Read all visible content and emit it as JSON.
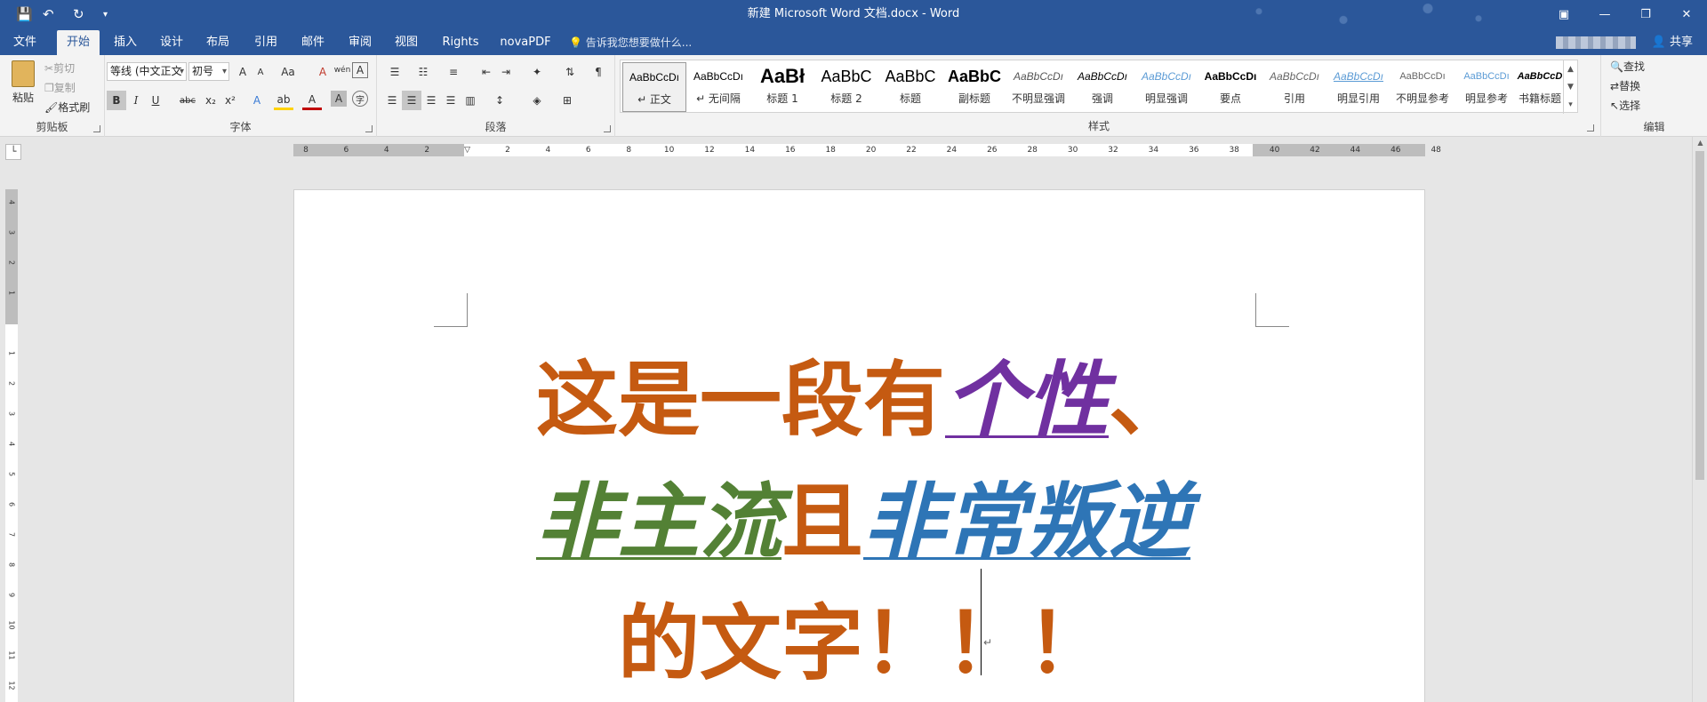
{
  "window": {
    "title": "新建 Microsoft Word 文档.docx - Word",
    "minimize_icon": "—",
    "restore_icon": "❐",
    "close_icon": "✕",
    "ribbon_display_icon": "▣"
  },
  "quick_access": {
    "save_icon": "💾",
    "undo_icon": "↶",
    "redo_icon": "↻",
    "customize_icon": "▾"
  },
  "menu": {
    "tabs": [
      "文件",
      "开始",
      "插入",
      "设计",
      "布局",
      "引用",
      "邮件",
      "审阅",
      "视图",
      "Rights",
      "novaPDF"
    ],
    "active_tab": "开始",
    "tell_me": "告诉我您想要做什么...",
    "share": "共享"
  },
  "clipboard": {
    "paste": "粘贴",
    "cut": "剪切",
    "copy": "复制",
    "format_painter": "格式刷",
    "label": "剪贴板"
  },
  "font": {
    "name": "等线 (中文正文",
    "size": "初号",
    "grow": "A",
    "shrink": "A",
    "case": "Aa",
    "bold": "B",
    "italic": "I",
    "underline": "U",
    "strike": "abc",
    "subscript": "x₂",
    "superscript": "x²",
    "phonetic": "wén",
    "label": "字体"
  },
  "paragraph": {
    "label": "段落"
  },
  "styles": {
    "label": "样式",
    "items": [
      {
        "sample": "AaBbCcDı",
        "name": "↵ 正文"
      },
      {
        "sample": "AaBbCcDı",
        "name": "↵ 无间隔"
      },
      {
        "sample": "AaBł",
        "name": "标题 1"
      },
      {
        "sample": "AaBbC",
        "name": "标题 2"
      },
      {
        "sample": "AaBbC",
        "name": "标题"
      },
      {
        "sample": "AaBbC",
        "name": "副标题"
      },
      {
        "sample": "AaBbCcDı",
        "name": "不明显强调"
      },
      {
        "sample": "AaBbCcDı",
        "name": "强调"
      },
      {
        "sample": "AaBbCcDı",
        "name": "明显强调"
      },
      {
        "sample": "AaBbCcDı",
        "name": "要点"
      },
      {
        "sample": "AaBbCcDı",
        "name": "引用"
      },
      {
        "sample": "AaBbCcDı",
        "name": "明显引用"
      },
      {
        "sample": "AaBbCcDı",
        "name": "不明显参考"
      },
      {
        "sample": "AaBbCcDı",
        "name": "明显参考"
      },
      {
        "sample": "AaBbCcD",
        "name": "书籍标题"
      }
    ]
  },
  "editing": {
    "find": "查找",
    "replace": "替换",
    "select": "选择",
    "label": "编辑"
  },
  "ruler": {
    "corner": "└",
    "h_ticks": [
      "8",
      "6",
      "4",
      "2",
      "",
      "2",
      "4",
      "6",
      "8",
      "10",
      "12",
      "14",
      "16",
      "18",
      "20",
      "22",
      "24",
      "26",
      "28",
      "30",
      "32",
      "34",
      "36",
      "38",
      "40",
      "42",
      "44",
      "46",
      "48"
    ],
    "v_ticks": [
      "4",
      "3",
      "2",
      "1",
      "",
      "1",
      "2",
      "3",
      "4",
      "5",
      "6",
      "7",
      "8",
      "9",
      "10",
      "11",
      "12"
    ]
  },
  "document": {
    "segments": [
      {
        "text": "这是一段有",
        "style": "sp"
      },
      {
        "text": "个性",
        "style": "purple"
      },
      {
        "text": "、",
        "style": "sp"
      },
      {
        "text": "非主流",
        "style": "green"
      },
      {
        "text": "且",
        "style": "sp"
      },
      {
        "text": "非常叛逆",
        "style": "blue"
      },
      {
        "text": "的文字！！！",
        "style": "sp"
      }
    ],
    "paragraph_mark": "↵"
  }
}
